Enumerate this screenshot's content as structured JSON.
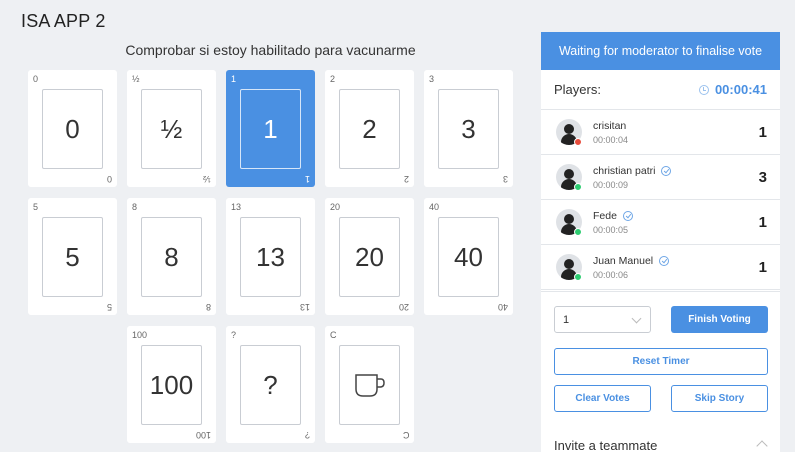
{
  "app": {
    "title": "ISA APP 2"
  },
  "story": {
    "title": "Comprobar si estoy habilitado para vacunarme"
  },
  "cards": [
    {
      "label": "0",
      "selected": false
    },
    {
      "label": "½",
      "selected": false
    },
    {
      "label": "1",
      "selected": true
    },
    {
      "label": "2",
      "selected": false
    },
    {
      "label": "3",
      "selected": false
    },
    {
      "label": "5",
      "selected": false
    },
    {
      "label": "8",
      "selected": false
    },
    {
      "label": "13",
      "selected": false
    },
    {
      "label": "20",
      "selected": false
    },
    {
      "label": "40",
      "selected": false
    },
    {
      "label": "100",
      "selected": false
    },
    {
      "label": "?",
      "selected": false
    },
    {
      "label": "C",
      "icon": "coffee-cup-icon",
      "selected": false
    }
  ],
  "panel": {
    "header": "Waiting for moderator to finalise vote",
    "players_label": "Players:",
    "timer": "00:00:41",
    "players": [
      {
        "name": "crisitan",
        "time": "00:00:04",
        "vote": "1",
        "status": "offline",
        "verified": false
      },
      {
        "name": "christian patri",
        "time": "00:00:09",
        "vote": "3",
        "status": "online",
        "verified": true
      },
      {
        "name": "Fede",
        "time": "00:00:05",
        "vote": "1",
        "status": "online",
        "verified": true
      },
      {
        "name": "Juan Manuel",
        "time": "00:00:06",
        "vote": "1",
        "status": "online",
        "verified": true
      }
    ],
    "select_value": "1",
    "finish_label": "Finish Voting",
    "reset_label": "Reset Timer",
    "clear_label": "Clear Votes",
    "skip_label": "Skip Story",
    "invite_label": "Invite a teammate"
  },
  "colors": {
    "accent": "#4a90e2",
    "online": "#2ecc71",
    "offline": "#e74c3c"
  }
}
